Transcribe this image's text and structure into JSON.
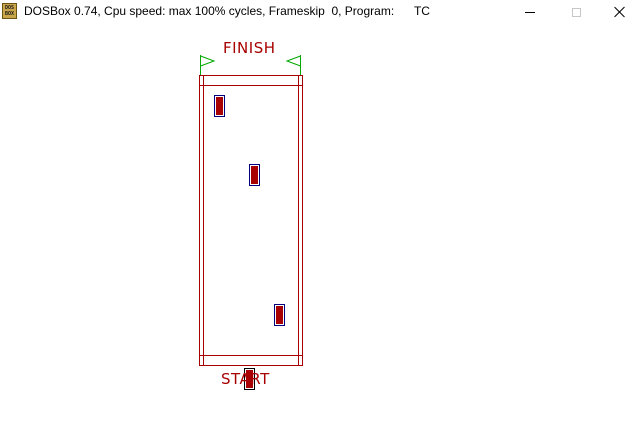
{
  "window": {
    "title": "DOSBox 0.74, Cpu speed: max 100% cycles, Frameskip  0, Program:      TC",
    "icon": "dosbox-icon",
    "icon_text": "DOS BOX",
    "buttons": {
      "minimize": "minimize-icon",
      "maximize": "maximize-icon",
      "close": "close-icon"
    }
  },
  "game": {
    "finish_label": "FINISH",
    "start_label": "START",
    "colors": {
      "track": "#a80000",
      "car_fill": "#a80000",
      "car_outline": "#000080",
      "flag": "#00a800",
      "background": "#ffffff"
    }
  }
}
